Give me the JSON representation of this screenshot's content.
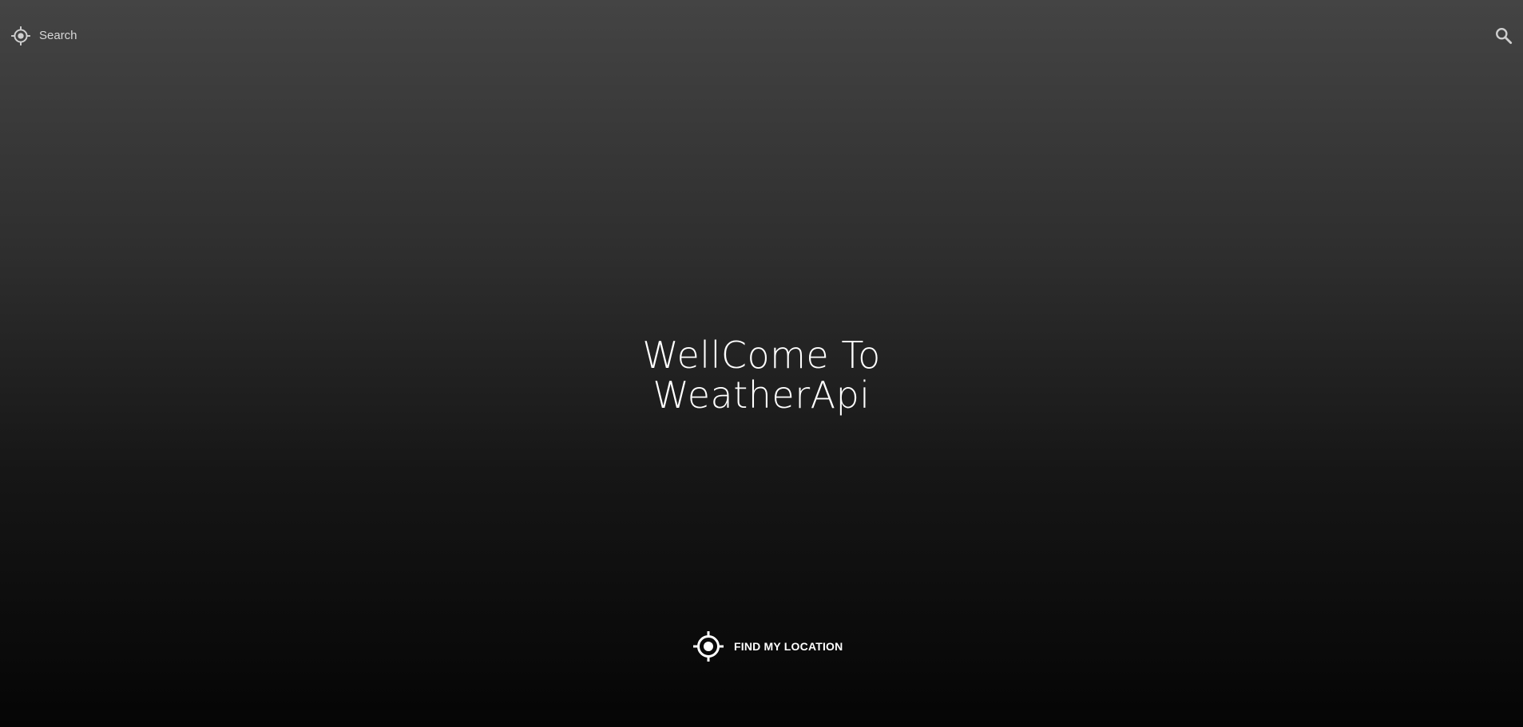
{
  "header": {
    "locate_icon": "crosshair-gps-icon",
    "search_placeholder": "Search",
    "search_icon": "magnifier-icon"
  },
  "hero": {
    "line1": "WellCome To",
    "line2": "WeatherApi"
  },
  "find_location": {
    "icon": "crosshair-gps-icon",
    "label": "FIND MY LOCATION"
  },
  "colors": {
    "text": "#ffffff",
    "icon_gray": "#cfcfcf",
    "bg_top": "#444444",
    "bg_bottom": "#050505"
  }
}
